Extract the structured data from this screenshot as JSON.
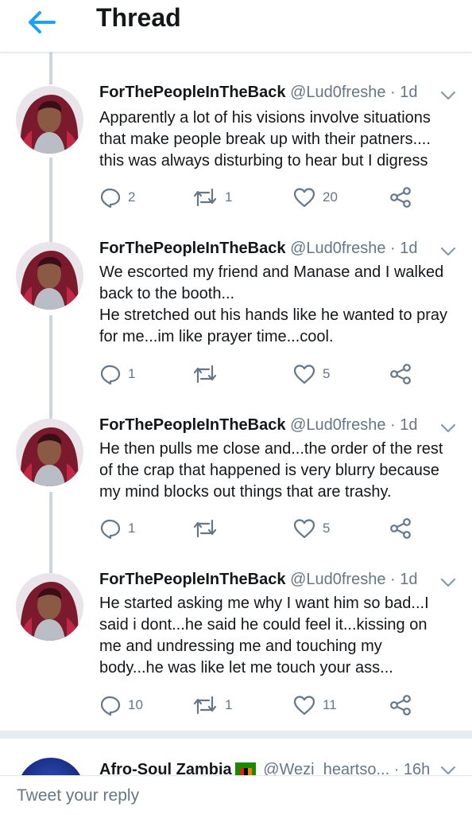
{
  "header": {
    "title": "Thread",
    "back_icon": "arrow-left-icon",
    "accent_color": "#1da1f2"
  },
  "tweets": [
    {
      "name": "ForThePeopleInTheBack",
      "handle": "@Lud0freshe",
      "time": "· 1d",
      "lines": [
        "Apparently a lot of his visions involve situations",
        "that make people break up with their patners....",
        "this was always disturbing to hear but I digress"
      ],
      "replies": "2",
      "retweets": "1",
      "likes": "20"
    },
    {
      "name": "ForThePeopleInTheBack",
      "handle": "@Lud0freshe",
      "time": "· 1d",
      "lines": [
        "We escorted my friend and Manase and I walked",
        "back to the booth...",
        "He stretched out his hands like he wanted to pray",
        "for me...im like prayer time...cool."
      ],
      "replies": "1",
      "retweets": "",
      "likes": "5"
    },
    {
      "name": "ForThePeopleInTheBack",
      "handle": "@Lud0freshe",
      "time": "· 1d",
      "lines": [
        "He then pulls me close and...the order of the rest",
        "of the crap that happened is very blurry because",
        "my mind blocks out things that are trashy."
      ],
      "replies": "1",
      "retweets": "",
      "likes": "5"
    },
    {
      "name": "ForThePeopleInTheBack",
      "handle": "@Lud0freshe",
      "time": "· 1d",
      "lines": [
        "He started asking me why I want him so bad...I",
        "said i dont...he said he could feel it...kissing  on",
        "me and undressing me and touching my",
        "body...he was like let me touch your ass..."
      ],
      "replies": "10",
      "retweets": "1",
      "likes": "11"
    }
  ],
  "next_tweet": {
    "name": "Afro-Soul Zambia",
    "handle": "@Wezi_heartso...",
    "time": "· 16h"
  },
  "reply": {
    "placeholder": "Tweet your reply"
  },
  "icons": {
    "reply": "reply-icon",
    "retweet": "retweet-icon",
    "like": "heart-icon",
    "share": "share-icon",
    "more": "chevron-down-icon",
    "flag": "zambia-flag-icon"
  }
}
